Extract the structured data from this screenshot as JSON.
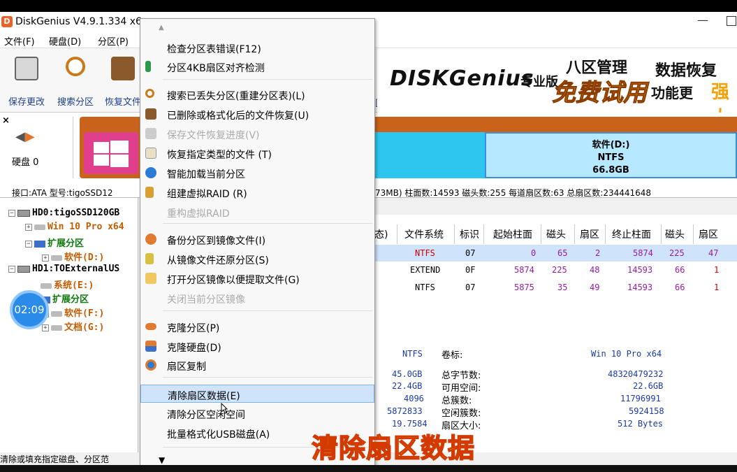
{
  "window": {
    "title": "DiskGenius V4.9.1.334 x6"
  },
  "menubar": [
    {
      "label": "文件(F)"
    },
    {
      "label": "硬盘(D)"
    },
    {
      "label": "分区(P)"
    }
  ],
  "toolbar": [
    {
      "label": "保存更改",
      "icon": "save-icon"
    },
    {
      "label": "搜索分区",
      "icon": "search-icon"
    },
    {
      "label": "恢复文件",
      "icon": "recover-icon"
    }
  ],
  "banner": {
    "logo": "DISKGenius",
    "edition": "专业版",
    "promo_a": "八区管理",
    "promo_b": "免费试用",
    "promo_c": "功能更",
    "promo_d": "强大",
    "promo_e": "数据恢复"
  },
  "disk_panel": {
    "disk_label": "硬盘 0",
    "partition_label": "软件(D:)",
    "partition_fs": "NTFS",
    "partition_size": "66.8GB",
    "info": "接口:ATA  型号:tigoSSD12",
    "info_right": "73MB)  柱面数:14593  磁头数:255  每道扇区数:63  总扇区数:234441648"
  },
  "tree": [
    {
      "label": "HD0:tigoSSD120GB"
    },
    {
      "label": "Win 10 Pro x64"
    },
    {
      "label": "扩展分区"
    },
    {
      "label": "软件(D:)"
    },
    {
      "label": "HD1:TOExternalUS"
    },
    {
      "label": "系统(E:)"
    },
    {
      "label": "扩展分区"
    },
    {
      "label": "软件(F:)"
    },
    {
      "label": "文档(G:)"
    }
  ],
  "timer": "02:09",
  "table": {
    "headers": [
      "态)",
      "文件系统",
      "标识",
      "起始柱面",
      "磁头",
      "扇区",
      "终止柱面",
      "磁头",
      "扇区"
    ],
    "rows": [
      [
        "NTFS",
        "07",
        "0",
        "65",
        "2",
        "5874",
        "225",
        "47"
      ],
      [
        "EXTEND",
        "0F",
        "5874",
        "225",
        "48",
        "14593",
        "66",
        "1"
      ],
      [
        "NTFS",
        "07",
        "5875",
        "35",
        "49",
        "14593",
        "66",
        "1"
      ]
    ]
  },
  "detail": {
    "fs": "NTFS",
    "vol_label_key": "卷标:",
    "vol_label_val": "Win 10 Pro x64",
    "left_vals": [
      "45.0GB",
      "22.4GB",
      "4096",
      "5872833",
      "19.7584"
    ],
    "keys": [
      "总字节数:",
      "可用空间:",
      "总簇数:",
      "空闲簇数:",
      "扇区大小:"
    ],
    "right_vals": [
      "48320479232",
      "22.6GB",
      "11796991",
      "5924158",
      "512 Bytes"
    ]
  },
  "status": "清除或填充指定磁盘、分区范",
  "context_menu": {
    "items": [
      {
        "label": "检查分区表错误(F12)",
        "icon": "none",
        "disabled": false
      },
      {
        "label": "分区4KB扇区对齐检测",
        "icon": "align-icon",
        "disabled": false
      },
      {
        "label": "搜索已丢失分区(重建分区表)(L)",
        "icon": "search-icon",
        "disabled": false
      },
      {
        "label": "已删除或格式化后的文件恢复(U)",
        "icon": "recover-icon",
        "disabled": false
      },
      {
        "label": "保存文件恢复进度(V)",
        "icon": "save-icon",
        "disabled": true
      },
      {
        "label": "恢复指定类型的文件 (T)",
        "icon": "file-icon",
        "disabled": false
      },
      {
        "label": "智能加载当前分区",
        "icon": "load-icon",
        "disabled": false
      },
      {
        "label": "组建虚拟RAID (R)",
        "icon": "raid-icon",
        "disabled": false
      },
      {
        "label": "重构虚拟RAID",
        "icon": "none",
        "disabled": true
      },
      {
        "label": "备份分区到镜像文件(I)",
        "icon": "backup-icon",
        "disabled": false
      },
      {
        "label": "从镜像文件还原分区(S)",
        "icon": "restore-icon",
        "disabled": false
      },
      {
        "label": "打开分区镜像以便提取文件(G)",
        "icon": "folder-icon",
        "disabled": false
      },
      {
        "label": "关闭当前分区镜像",
        "icon": "none",
        "disabled": true
      },
      {
        "label": "克隆分区(P)",
        "icon": "clone-partition-icon",
        "disabled": false
      },
      {
        "label": "克隆硬盘(D)",
        "icon": "clone-disk-icon",
        "disabled": false
      },
      {
        "label": "扇区复制",
        "icon": "sector-copy-icon",
        "disabled": false
      },
      {
        "label": "清除扇区数据(E)",
        "icon": "none",
        "disabled": false,
        "highlighted": true
      },
      {
        "label": "清除分区空闲空间",
        "icon": "none",
        "disabled": false
      },
      {
        "label": "批量格式化USB磁盘(A)",
        "icon": "none",
        "disabled": false
      }
    ]
  },
  "caption": "清除扇区数据",
  "colors": {
    "accent": "#c9621a",
    "partition_blue": "#2ec5ef",
    "highlight": "#cfe3fb",
    "caption": "#ffdd00"
  }
}
